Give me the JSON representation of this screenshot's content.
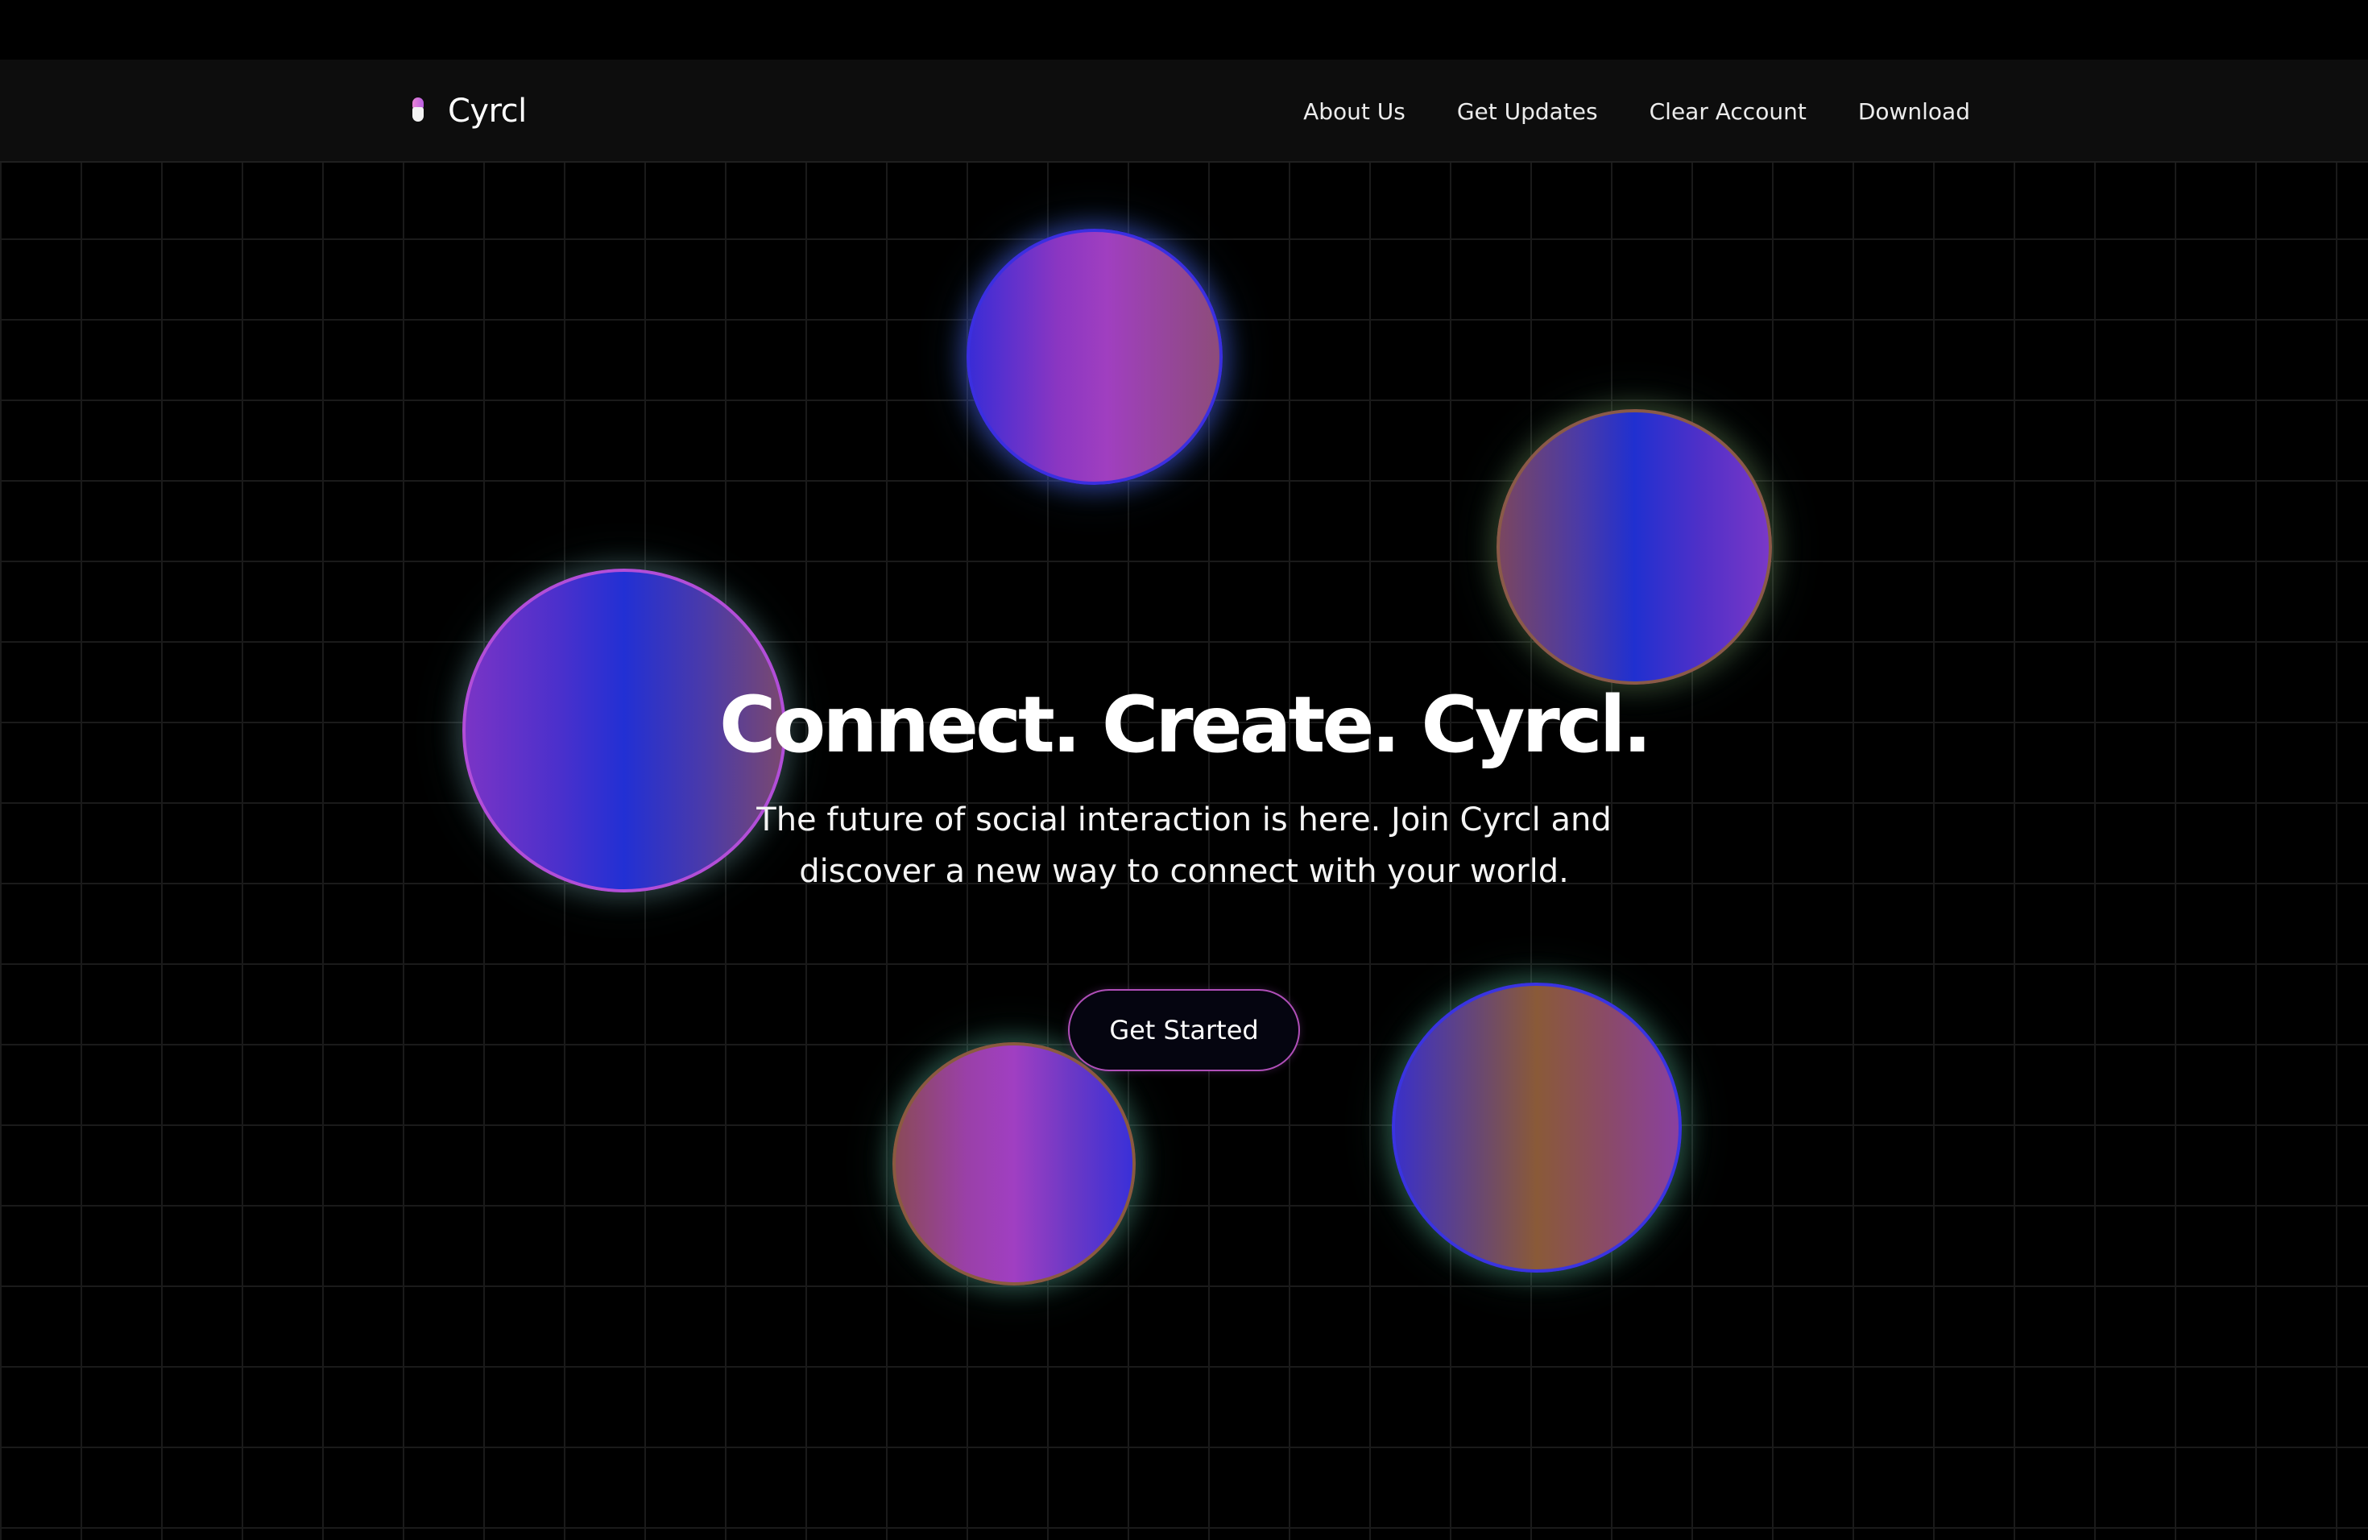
{
  "brand": {
    "name": "Cyrcl",
    "logo_icon": "capsule-logo-icon"
  },
  "nav": {
    "links": [
      {
        "label": "About Us"
      },
      {
        "label": "Get Updates"
      },
      {
        "label": "Clear Account"
      },
      {
        "label": "Download"
      }
    ]
  },
  "hero": {
    "title": "Connect. Create. Cyrcl.",
    "subtitle": "The future of social interaction is here. Join Cyrcl and discover a new way to connect with your world.",
    "cta_label": "Get Started"
  },
  "colors": {
    "background": "#000000",
    "navbar": "#0d0d0d",
    "accent_purple": "#a03fc0",
    "accent_blue": "#2230d4",
    "cta_border": "#b04fb8"
  }
}
